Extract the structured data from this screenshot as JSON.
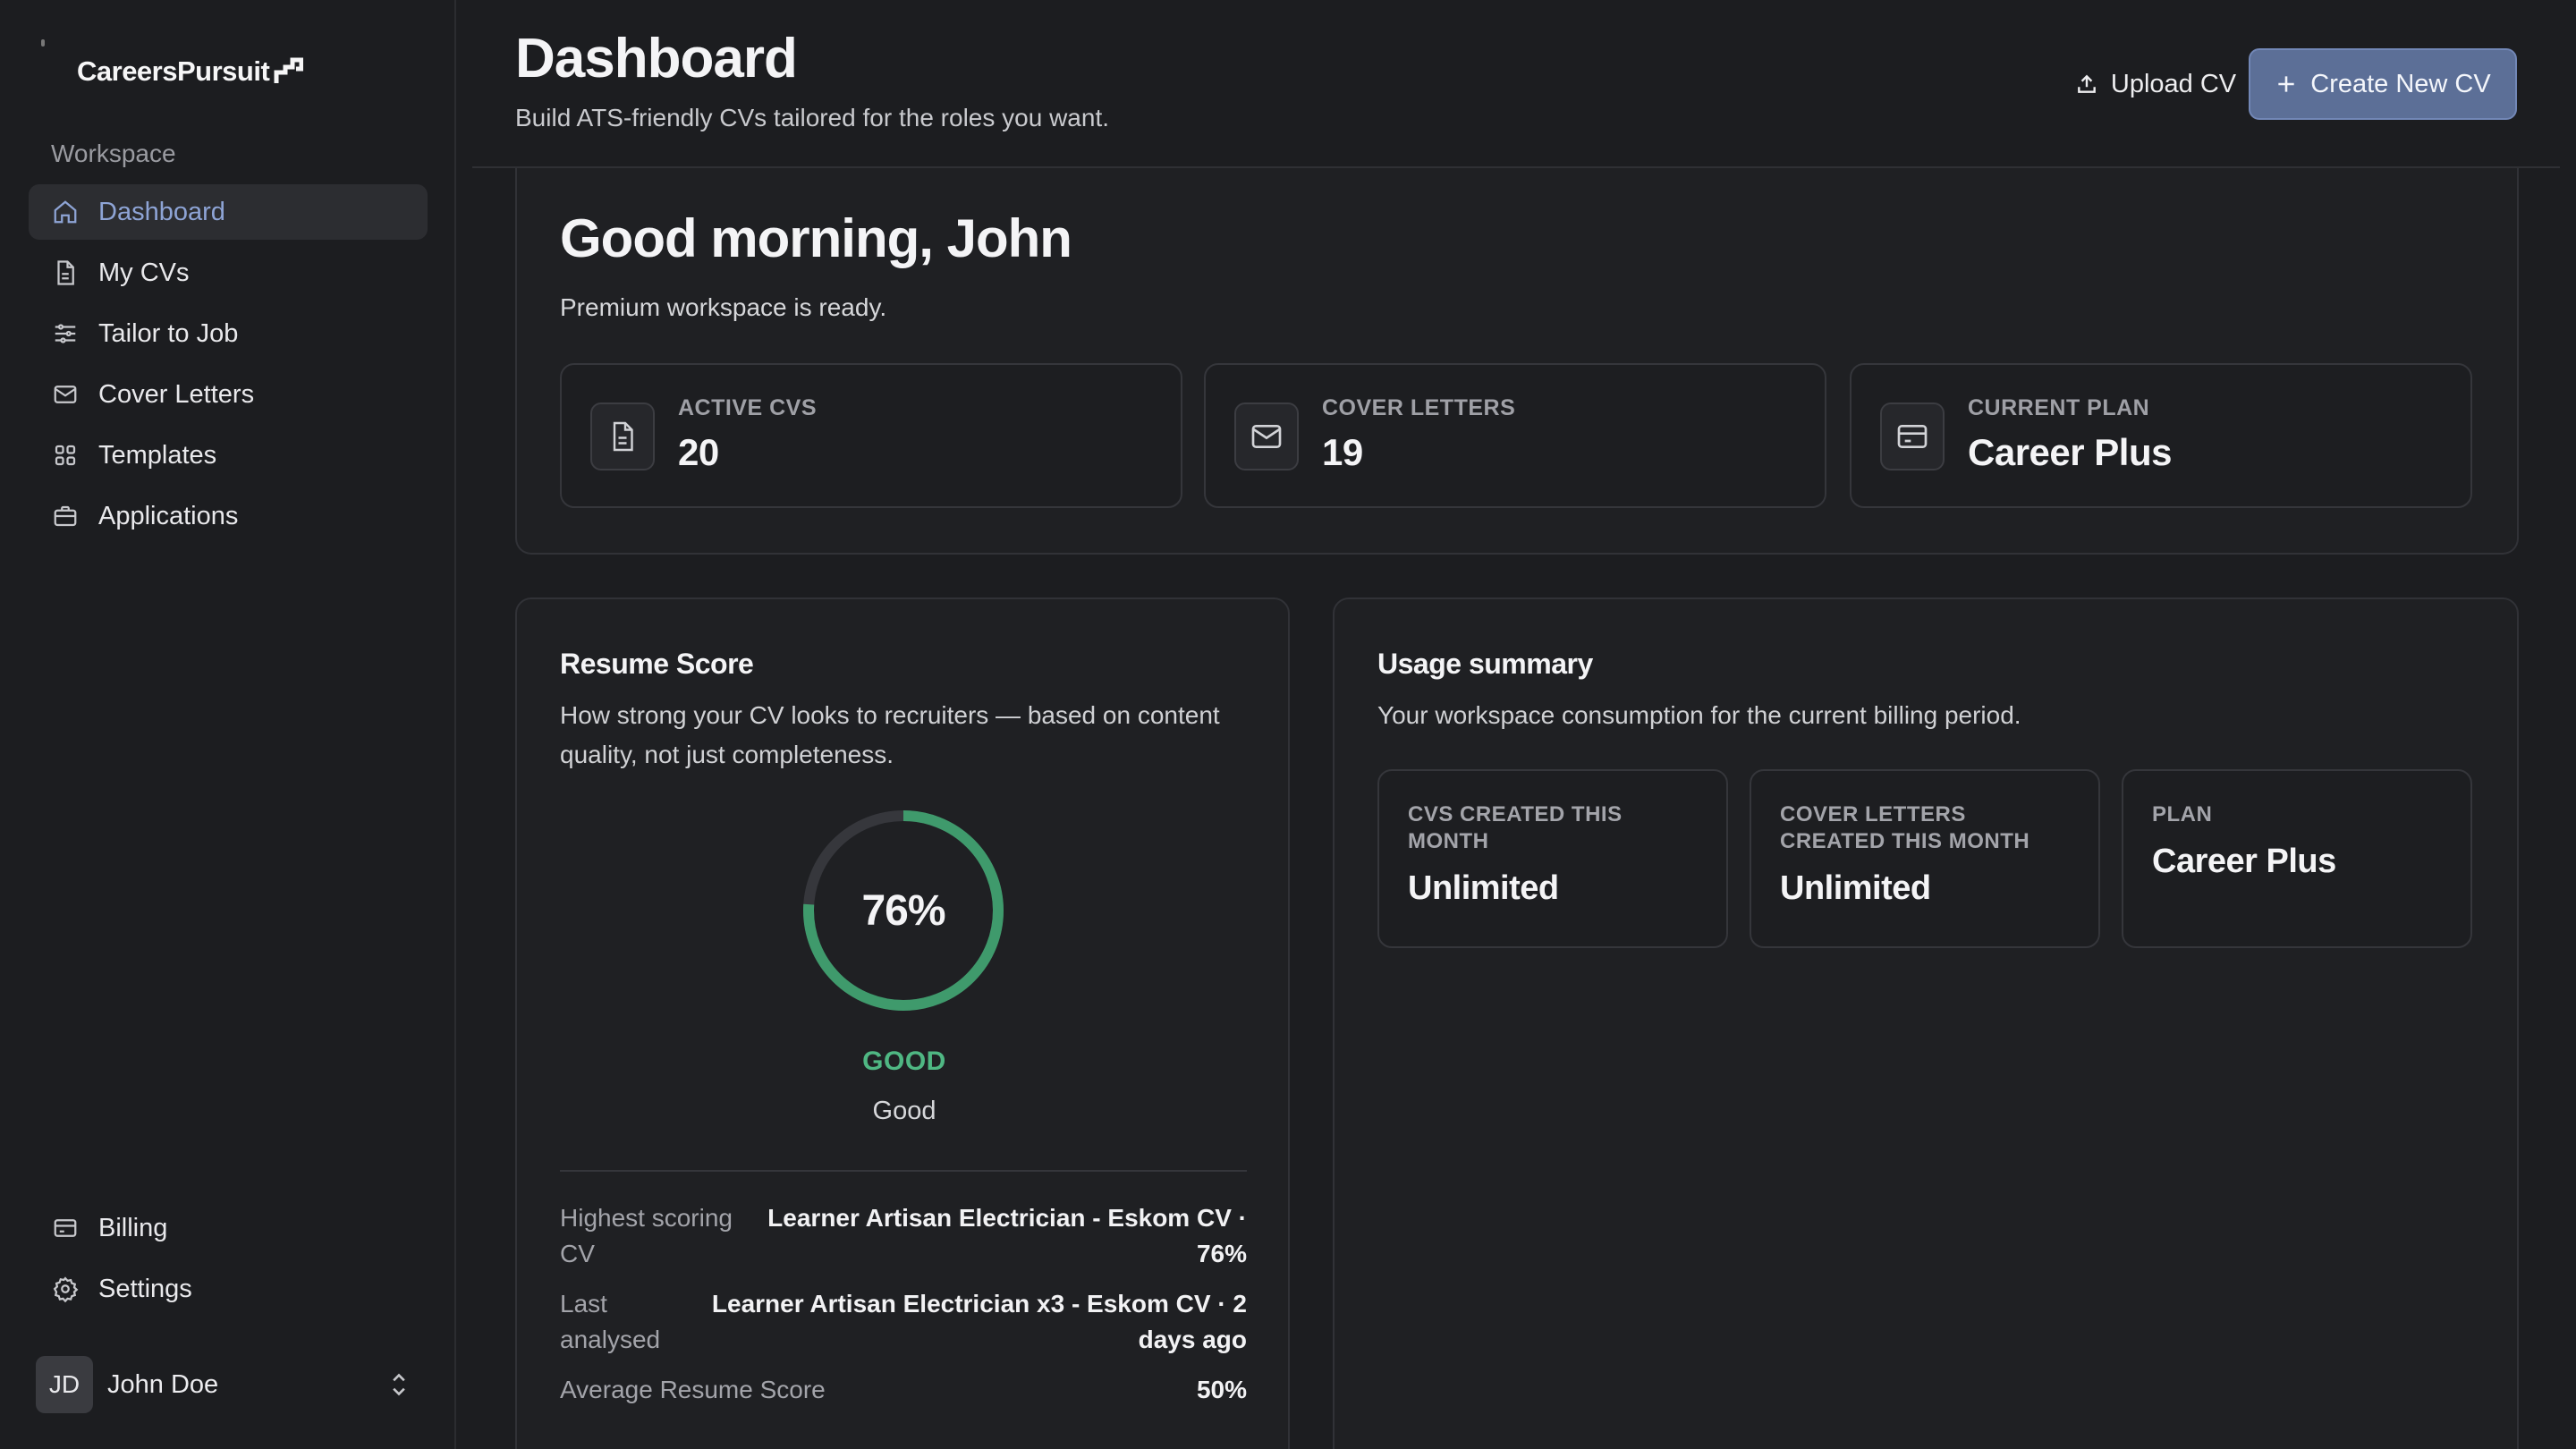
{
  "app": {
    "name": "CareersPursuit"
  },
  "sidebar": {
    "section_label": "Workspace",
    "items": [
      {
        "label": "Dashboard",
        "icon": "home-icon",
        "active": true
      },
      {
        "label": "My CVs",
        "icon": "document-icon"
      },
      {
        "label": "Tailor to Job",
        "icon": "sliders-icon"
      },
      {
        "label": "Cover Letters",
        "icon": "mail-icon"
      },
      {
        "label": "Templates",
        "icon": "grid-icon"
      },
      {
        "label": "Applications",
        "icon": "briefcase-icon"
      }
    ],
    "bottom_items": [
      {
        "label": "Billing",
        "icon": "credit-card-icon"
      },
      {
        "label": "Settings",
        "icon": "gear-icon"
      }
    ],
    "user": {
      "initials": "JD",
      "name": "John Doe"
    }
  },
  "header": {
    "title": "Dashboard",
    "subtitle": "Build ATS-friendly CVs tailored for the roles you want.",
    "upload_label": "Upload CV",
    "create_label": "Create New CV"
  },
  "welcome": {
    "greeting": "Good morning, John",
    "subtitle": "Premium workspace is ready.",
    "stats": [
      {
        "label": "ACTIVE CVS",
        "value": "20",
        "icon": "document-icon"
      },
      {
        "label": "COVER LETTERS",
        "value": "19",
        "icon": "mail-icon"
      },
      {
        "label": "CURRENT PLAN",
        "value": "Career Plus",
        "icon": "credit-card-icon"
      }
    ]
  },
  "resume_score": {
    "title": "Resume Score",
    "description": "How strong your CV looks to recruiters — based on content quality, not just completeness.",
    "percent": 76,
    "percent_label": "76%",
    "grade": "GOOD",
    "grade_text": "Good",
    "details": [
      {
        "label": "Highest scoring CV",
        "value": "Learner Artisan Electrician - Eskom CV · 76%"
      },
      {
        "label": "Last analysed",
        "value": "Learner Artisan Electrician x3 - Eskom CV · 2 days ago"
      },
      {
        "label": "Average Resume Score",
        "value": "50%"
      }
    ],
    "colors": {
      "ring": "#3f9a6c",
      "track": "#36373c",
      "grade": "#4fb783"
    }
  },
  "usage": {
    "title": "Usage summary",
    "description": "Your workspace consumption for the current billing period.",
    "stats": [
      {
        "label": "CVS CREATED THIS MONTH",
        "value": "Unlimited"
      },
      {
        "label": "COVER LETTERS CREATED THIS MONTH",
        "value": "Unlimited"
      },
      {
        "label": "PLAN",
        "value": "Career Plus"
      }
    ]
  },
  "colors": {
    "accent": "#5c6f97",
    "active_nav": "#8ea4d6",
    "background": "#1c1d20"
  }
}
